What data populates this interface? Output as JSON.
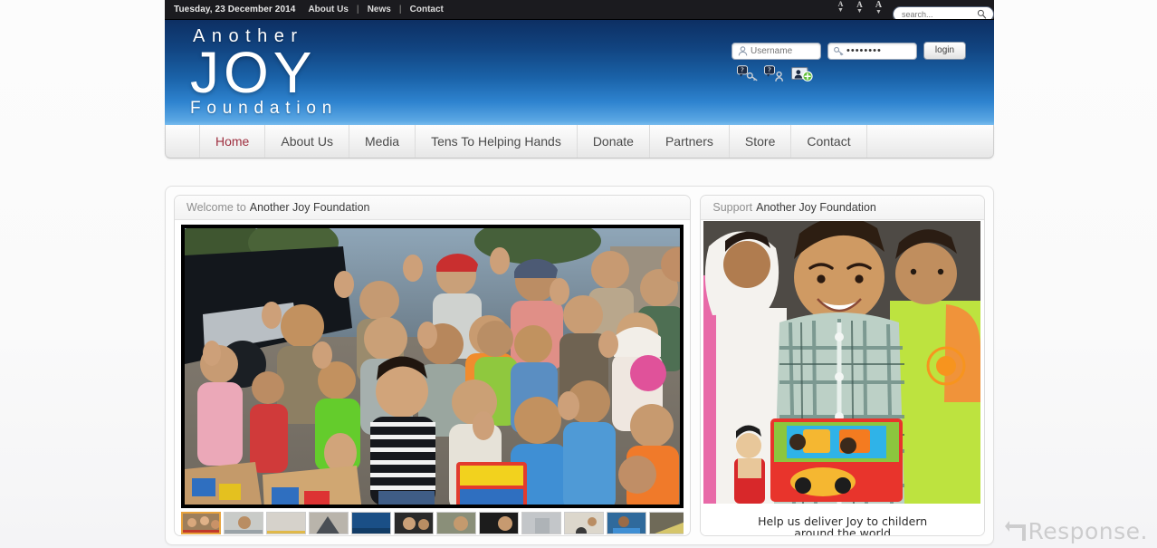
{
  "topbar": {
    "date": "Tuesday, 23 December 2014",
    "links": [
      "About Us",
      "News",
      "Contact"
    ],
    "separator": "|",
    "font_sizer": {
      "label": "A",
      "increase_icon": "font-increase-icon",
      "reset_icon": "font-reset-icon",
      "decrease_icon": "font-decrease-icon"
    },
    "search": {
      "placeholder": "search...",
      "value": "",
      "icon": "search-icon"
    }
  },
  "header": {
    "logo": {
      "line1": "Another",
      "line2": "JOY",
      "line3": "Foundation"
    },
    "login": {
      "username_placeholder": "Username",
      "username_value": "",
      "username_icon": "user-icon",
      "password_value": "••••••••",
      "password_icon": "key-icon",
      "button_label": "login",
      "help_icons": [
        "forgot-password-icon",
        "forgot-username-icon",
        "register-account-icon"
      ]
    },
    "colors": {
      "gradient_top": "#0d2f63",
      "gradient_bottom": "#79bcee"
    }
  },
  "nav": {
    "items": [
      {
        "label": "Home",
        "active": true
      },
      {
        "label": "About Us",
        "active": false
      },
      {
        "label": "Media",
        "active": false
      },
      {
        "label": "Tens To Helping Hands",
        "active": false
      },
      {
        "label": "Donate",
        "active": false
      },
      {
        "label": "Partners",
        "active": false
      },
      {
        "label": "Store",
        "active": false
      },
      {
        "label": "Contact",
        "active": false
      }
    ],
    "active_color": "#9e2e3e"
  },
  "main": {
    "left_panel": {
      "title_light": "Welcome to",
      "title_dark": "Another Joy Foundation",
      "hero_alt": "Man kneeling among many waving children with boxes of donated toys",
      "thumbnail_count": 12,
      "active_thumbnail": 1,
      "active_thumb_color": "#e8a33d"
    },
    "right_panel": {
      "title_light": "Support",
      "title_dark": "Another Joy Foundation",
      "image_alt": "Smiling boy holding a boxed toy between two other children",
      "caption_line1": "Help us deliver Joy to childern",
      "caption_line2": "around the world"
    }
  },
  "watermark": {
    "text": "Response.",
    "icon": "arrow-left-icon"
  }
}
